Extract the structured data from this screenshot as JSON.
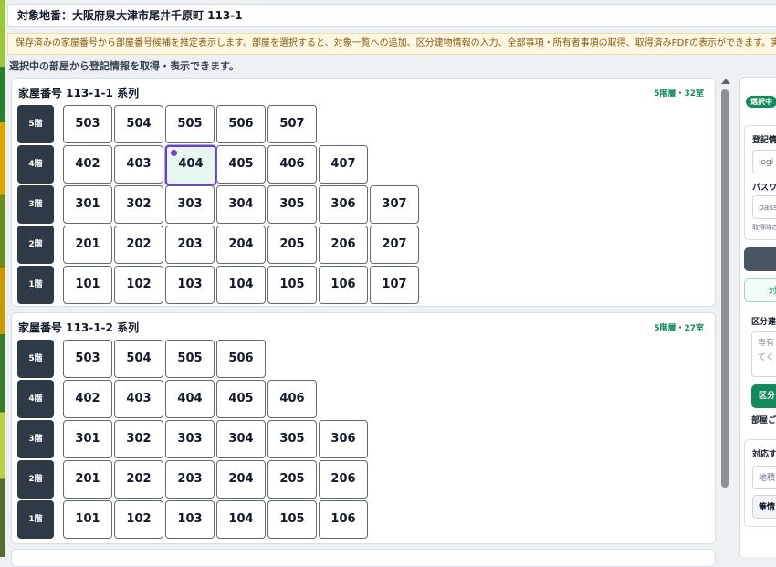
{
  "header": {
    "target_parcel": "対象地番：大阪府泉大津市尾井千原町 113-1"
  },
  "notice": "保存済みの家屋番号から部屋番号候補を推定表示します。部屋を選択すると、対象一覧への追加、区分建物情報の入力、全部事項・所有者事項の取得、取得済みPDFの表示ができます。実",
  "helper_text": "選択中の部屋から登記情報を取得・表示できます。",
  "series": [
    {
      "title": "家屋番号 113-1-1 系列",
      "meta": "5階層・32室",
      "floors": [
        {
          "label": "5階",
          "rooms": [
            "503",
            "504",
            "505",
            "506",
            "507"
          ]
        },
        {
          "label": "4階",
          "rooms": [
            "402",
            "403",
            "404",
            "405",
            "406",
            "407"
          ]
        },
        {
          "label": "3階",
          "rooms": [
            "301",
            "302",
            "303",
            "304",
            "305",
            "306",
            "307"
          ]
        },
        {
          "label": "2階",
          "rooms": [
            "201",
            "202",
            "203",
            "204",
            "205",
            "206",
            "207"
          ]
        },
        {
          "label": "1階",
          "rooms": [
            "101",
            "102",
            "103",
            "104",
            "105",
            "106",
            "107"
          ]
        }
      ]
    },
    {
      "title": "家屋番号 113-1-2 系列",
      "meta": "5階層・27室",
      "floors": [
        {
          "label": "5階",
          "rooms": [
            "503",
            "504",
            "505",
            "506"
          ]
        },
        {
          "label": "4階",
          "rooms": [
            "402",
            "403",
            "404",
            "405",
            "406"
          ]
        },
        {
          "label": "3階",
          "rooms": [
            "301",
            "302",
            "303",
            "304",
            "305",
            "306"
          ]
        },
        {
          "label": "2階",
          "rooms": [
            "201",
            "202",
            "203",
            "204",
            "205",
            "206"
          ]
        },
        {
          "label": "1階",
          "rooms": [
            "101",
            "102",
            "103",
            "104",
            "105",
            "106"
          ]
        }
      ]
    }
  ],
  "selected_room": {
    "series_index": 0,
    "room": "404"
  },
  "side_panel": {
    "badge": "選択中",
    "login_section_label": "登記情",
    "login_placeholder": "logi",
    "password_label": "パスワ",
    "password_placeholder": "pass",
    "hint_text": "取得時の",
    "outline_button_label": "対",
    "info_section_label": "区分建",
    "textarea_placeholder": "専有\nてく",
    "green_button_label": "区分",
    "footer_label": "部屋ご",
    "target_section_label": "対応す",
    "target_input_value": "地積",
    "target_button_label": "筆情"
  },
  "colors": {
    "accent_green": "#138a5b",
    "selection_purple": "#6b3fc9",
    "floor_badge": "#2f3a48"
  }
}
